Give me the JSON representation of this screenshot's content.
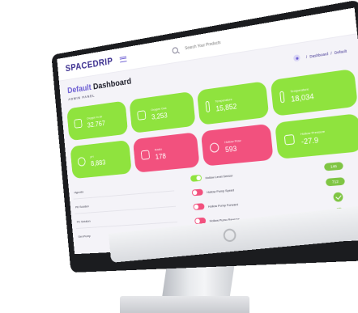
{
  "header": {
    "logo": "SPACEDRIP",
    "search_placeholder": "Search Your Products",
    "breadcrumb_home": "Dashboard",
    "breadcrumb_current": "Default"
  },
  "page": {
    "title_accent": "Default",
    "title_rest": "Dashboard",
    "subtitle": "ADMIN PANEL"
  },
  "cards": [
    {
      "label": "Oxygen In air",
      "value": "32.767",
      "color": "#8fe33e",
      "icon": "battery-icon"
    },
    {
      "label": "Oxygen Gas",
      "value": "3,253",
      "color": "#8fe33e",
      "icon": "calendar-icon"
    },
    {
      "label": "Temperature",
      "value": "15,852",
      "color": "#8fe33e",
      "icon": "thermometer-icon"
    },
    {
      "label": "Temperature",
      "value": "18,034",
      "color": "#8fe33e",
      "icon": "thermometer-icon"
    },
    {
      "label": "pH",
      "value": "8,883",
      "color": "#8fe33e",
      "icon": "drop-icon"
    },
    {
      "label": "Radio",
      "value": "178",
      "color": "#f2517e",
      "icon": "cast-icon"
    },
    {
      "label": "Hollow Flow",
      "value": "593",
      "color": "#f2517e",
      "icon": "compass-icon"
    },
    {
      "label": "Hollow Pressure",
      "value": "-27.9",
      "color": "#8fe33e",
      "icon": "layers-icon"
    }
  ],
  "sensors": {
    "left_labels": [
      "Hypoxia",
      "PD Solution",
      "PC Solution",
      "Gen Pump"
    ],
    "toggles": [
      {
        "label": "Hollow Level Sensor",
        "state": "on"
      },
      {
        "label": "Hollow Pump Speed",
        "state": "off"
      },
      {
        "label": "Hollow Pump Forward",
        "state": "off"
      },
      {
        "label": "Hollow Pump Reverse",
        "state": "off"
      }
    ],
    "readouts": [
      "146",
      "712"
    ]
  },
  "colors": {
    "brand": "#3b2e8f",
    "accent": "#6c5dd3",
    "green": "#8fe33e",
    "pink": "#f2517e"
  }
}
